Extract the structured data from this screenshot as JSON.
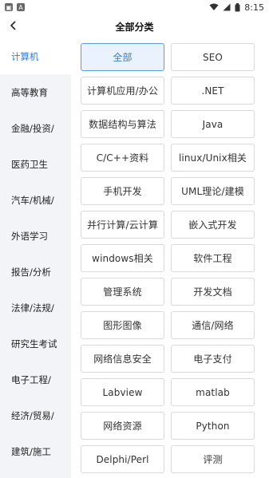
{
  "status_bar": {
    "time": "8:15"
  },
  "header": {
    "title": "全部分类"
  },
  "sidebar": {
    "items": [
      {
        "label": "计算机",
        "active": true
      },
      {
        "label": "高等教育",
        "active": false
      },
      {
        "label": "金融/投资/",
        "active": false
      },
      {
        "label": "医药卫生",
        "active": false
      },
      {
        "label": "汽车/机械/",
        "active": false
      },
      {
        "label": "外语学习",
        "active": false
      },
      {
        "label": "报告/分析",
        "active": false
      },
      {
        "label": "法律/法规/",
        "active": false
      },
      {
        "label": "研究生考试",
        "active": false
      },
      {
        "label": "电子工程/",
        "active": false
      },
      {
        "label": "经济/贸易/",
        "active": false
      },
      {
        "label": "建筑/施工",
        "active": false
      }
    ]
  },
  "categories": [
    {
      "label": "全部",
      "active": true
    },
    {
      "label": "SEO",
      "active": false
    },
    {
      "label": "计算机应用/办公",
      "active": false
    },
    {
      "label": ".NET",
      "active": false
    },
    {
      "label": "数据结构与算法",
      "active": false
    },
    {
      "label": "Java",
      "active": false
    },
    {
      "label": "C/C++资料",
      "active": false
    },
    {
      "label": "linux/Unix相关",
      "active": false
    },
    {
      "label": "手机开发",
      "active": false
    },
    {
      "label": "UML理论/建模",
      "active": false
    },
    {
      "label": "并行计算/云计算",
      "active": false
    },
    {
      "label": "嵌入式开发",
      "active": false
    },
    {
      "label": "windows相关",
      "active": false
    },
    {
      "label": "软件工程",
      "active": false
    },
    {
      "label": "管理系统",
      "active": false
    },
    {
      "label": "开发文档",
      "active": false
    },
    {
      "label": "图形图像",
      "active": false
    },
    {
      "label": "通信/网络",
      "active": false
    },
    {
      "label": "网络信息安全",
      "active": false
    },
    {
      "label": "电子支付",
      "active": false
    },
    {
      "label": "Labview",
      "active": false
    },
    {
      "label": "matlab",
      "active": false
    },
    {
      "label": "网络资源",
      "active": false
    },
    {
      "label": "Python",
      "active": false
    },
    {
      "label": "Delphi/Perl",
      "active": false
    },
    {
      "label": "评测",
      "active": false
    }
  ],
  "colors": {
    "accent": "#2f7dd1",
    "sidebar_bg": "#f2f4f8",
    "active_btn_bg": "#eaf3fd"
  },
  "icons": {
    "back": "back-arrow-icon",
    "wifi": "wifi-icon",
    "signal": "signal-icon",
    "battery": "battery-icon"
  }
}
